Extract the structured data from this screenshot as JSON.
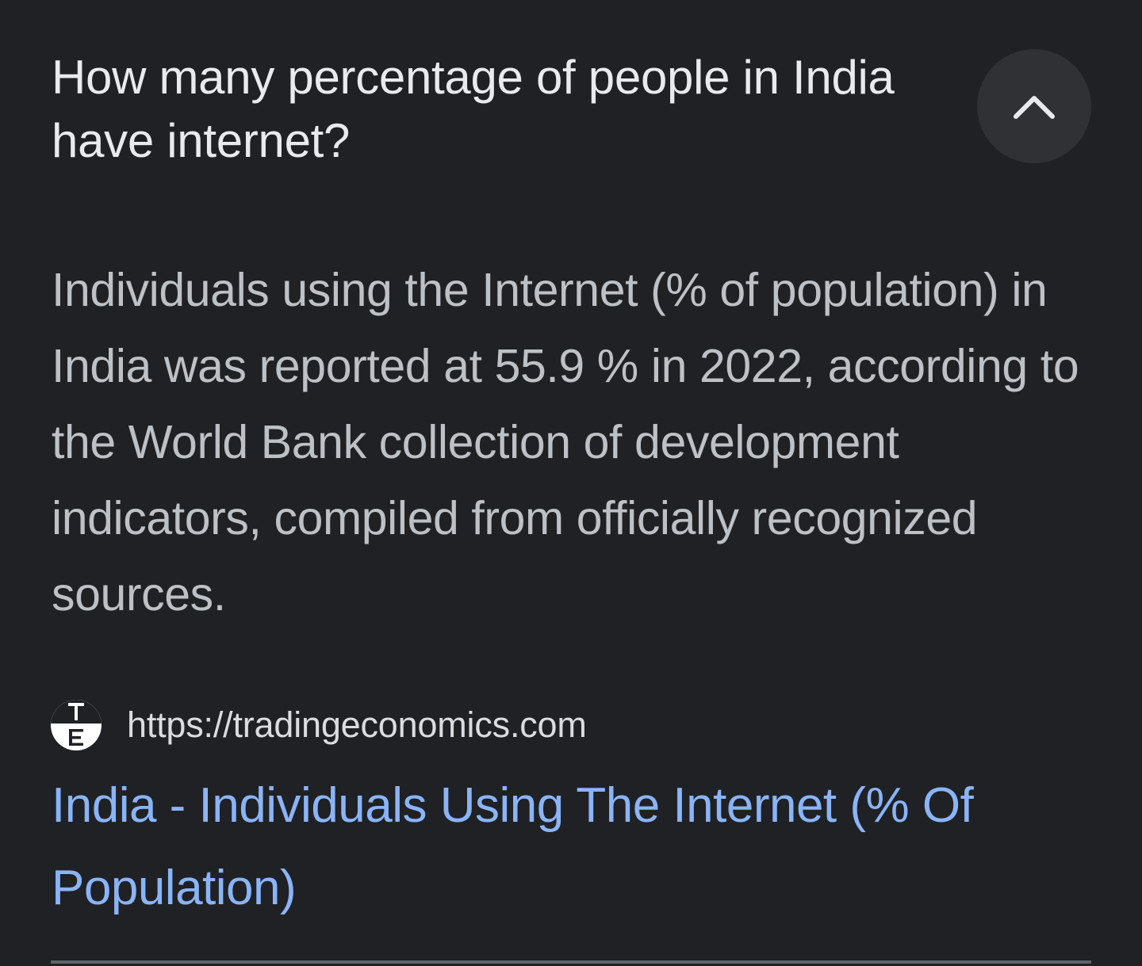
{
  "question": "How many percentage of people in India have internet?",
  "answer": "Individuals using the Internet (% of population) in India was reported at 55.9 % in 2022, according to the World Bank collection of development indicators, compiled from officially recognized sources.",
  "source": {
    "favicon_letters": "TE",
    "url": "https://tradingeconomics.com"
  },
  "result": {
    "title": "India - Individuals Using The Internet (% Of Population)"
  },
  "icons": {
    "collapse": "chevron-up-icon"
  },
  "colors": {
    "background": "#202124",
    "question_text": "#e8eaed",
    "answer_text": "#bdc1c6",
    "link": "#8ab4f8",
    "button_bg": "#303134"
  }
}
